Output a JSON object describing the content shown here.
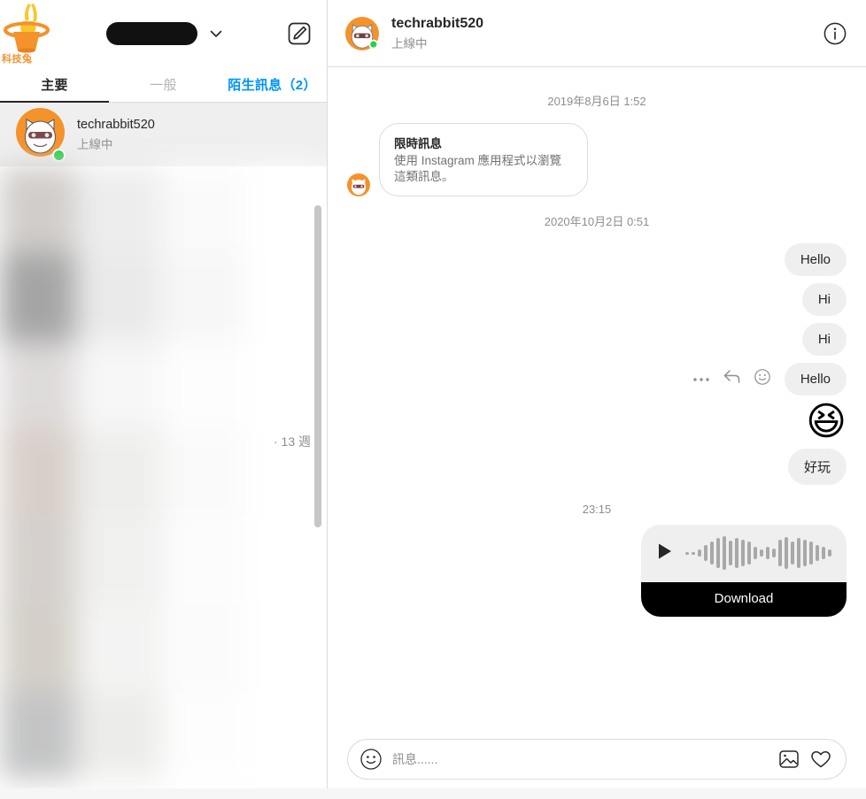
{
  "watermark": {
    "label": "科技兔",
    "icon": "rabbit-in-hat-logo",
    "color": "#f4922b"
  },
  "left_panel": {
    "toolbar": {
      "username_redacted": "",
      "chevron_icon": "chevron-down-icon",
      "compose_icon": "compose-message-icon"
    },
    "tabs": [
      {
        "label": "主要",
        "state": "active"
      },
      {
        "label": "一般",
        "state": "muted"
      },
      {
        "label": "陌生訊息（2）",
        "state": "accent"
      }
    ],
    "selected_conversation": {
      "name": "techrabbit520",
      "status": "上線中",
      "avatar": "cat-sunglasses-avatar",
      "presence": "online"
    },
    "blurred_rows_count": 7,
    "week_label": "· 13 週",
    "scrollbar": "visible"
  },
  "chat_header": {
    "title": "techrabbit520",
    "status": "上線中",
    "avatar": "cat-sunglasses-avatar",
    "info_icon": "info-circle-icon"
  },
  "messages": {
    "separator_1": "2019年8月6日 1:52",
    "incoming": {
      "title": "限時訊息",
      "body": "使用 Instagram 應用程式以瀏覽這類訊息。",
      "avatar": "cat-sunglasses-avatar"
    },
    "separator_2": "2020年10月2日 0:51",
    "outgoing": [
      {
        "text": "Hello",
        "type": "text"
      },
      {
        "text": "Hi",
        "type": "text"
      },
      {
        "text": "Hi",
        "type": "text"
      },
      {
        "text": "Hello",
        "type": "text",
        "hovered": true
      },
      {
        "text": "😆",
        "type": "emoji"
      },
      {
        "text": "好玩",
        "type": "text"
      }
    ],
    "hover_actions": {
      "more_icon": "more-dots-icon",
      "reply_icon": "reply-arrow-icon",
      "react_icon": "emoji-react-icon"
    },
    "time_label": "23:15",
    "audio": {
      "play_icon": "play-icon",
      "download_label": "Download",
      "waveform_heights": [
        3,
        3,
        8,
        18,
        26,
        34,
        38,
        28,
        34,
        30,
        26,
        14,
        8,
        14,
        10,
        30,
        36,
        26,
        34,
        30,
        26,
        18,
        14,
        8
      ]
    }
  },
  "composer": {
    "emoji_icon": "emoji-smiley-icon",
    "placeholder": "訊息......",
    "value": "",
    "image_icon": "image-icon",
    "heart_icon": "heart-icon"
  },
  "colors": {
    "accent": "#0095f6",
    "bubble": "#efefef",
    "text": "#262626",
    "muted": "#8e8e8e",
    "online": "#2ad14f",
    "brand_orange": "#f4922b"
  }
}
